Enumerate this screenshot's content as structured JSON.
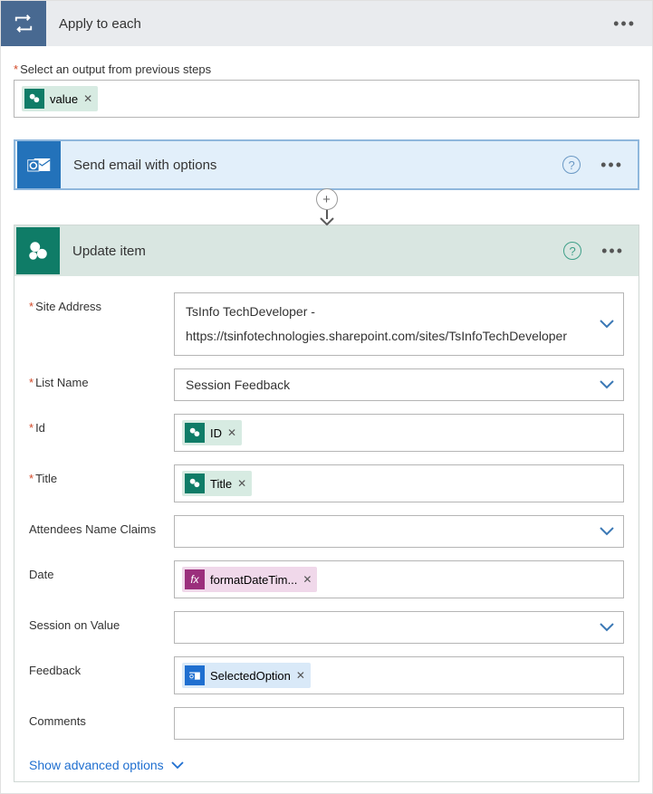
{
  "outer": {
    "title": "Apply to each",
    "select_label": "Select an output from previous steps",
    "value_token": "value"
  },
  "email_card": {
    "title": "Send email with options"
  },
  "update": {
    "title": "Update item",
    "fields": {
      "site_address": {
        "label": "Site Address",
        "line1": "TsInfo TechDeveloper -",
        "line2": "https://tsinfotechnologies.sharepoint.com/sites/TsInfoTechDeveloper"
      },
      "list_name": {
        "label": "List Name",
        "value": "Session Feedback"
      },
      "id": {
        "label": "Id",
        "token": "ID"
      },
      "title": {
        "label": "Title",
        "token": "Title"
      },
      "attendees": {
        "label": "Attendees Name Claims"
      },
      "date": {
        "label": "Date",
        "token": "formatDateTim..."
      },
      "session_on": {
        "label": "Session on Value"
      },
      "feedback": {
        "label": "Feedback",
        "token": "SelectedOption"
      },
      "comments": {
        "label": "Comments"
      }
    },
    "advanced": "Show advanced options"
  },
  "icons": {
    "fx": "fx",
    "help": "?"
  }
}
